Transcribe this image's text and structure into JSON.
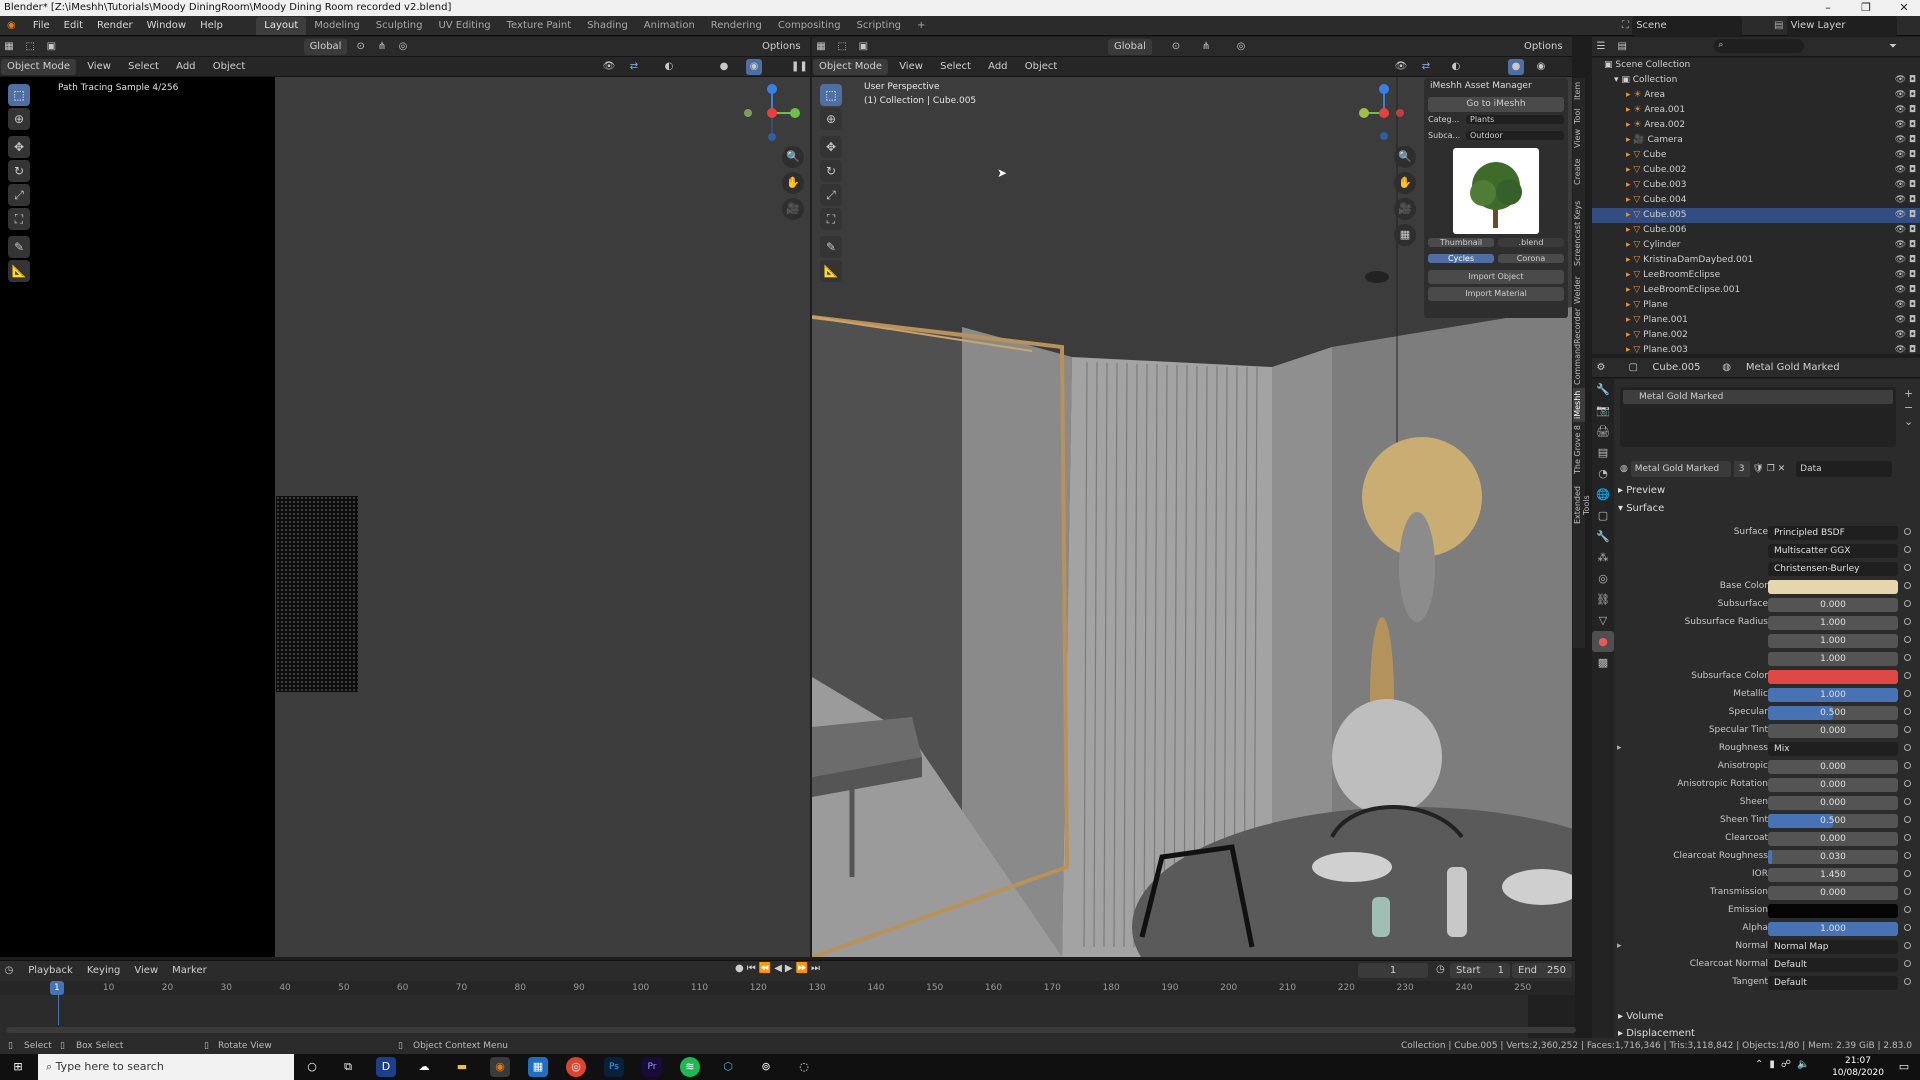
{
  "window": {
    "title": "Blender* [Z:\\iMeshh\\Tutorials\\Moody DiningRoom\\Moody Dining Room recorded v2.blend]"
  },
  "menu": [
    "File",
    "Edit",
    "Render",
    "Window",
    "Help"
  ],
  "workspaces": [
    "Layout",
    "Modeling",
    "Sculpting",
    "UV Editing",
    "Texture Paint",
    "Shading",
    "Animation",
    "Rendering",
    "Compositing",
    "Scripting",
    "+"
  ],
  "header": {
    "orientation": "Global",
    "options": "Options",
    "mode": "Object Mode",
    "view": "View",
    "select": "Select",
    "add": "Add",
    "object": "Object"
  },
  "left_viewport": {
    "overlay": "Path Tracing Sample 4/256"
  },
  "right_viewport": {
    "perspective": "User Perspective",
    "collection": "(1) Collection | Cube.005"
  },
  "imeshh": {
    "title": "iMeshh Asset Manager",
    "goto": "Go to iMeshh",
    "category_label": "Categ...",
    "category_value": "Plants",
    "subcategory_label": "Subca...",
    "subcategory_value": "Outdoor",
    "thumbnail": "Thumbnail",
    "blend": ".blend",
    "cycles": "Cycles",
    "corona": "Corona",
    "import_object": "Import Object",
    "import_material": "Import Material"
  },
  "side_tabs": [
    "Item",
    "Tool",
    "View",
    "Create",
    "Screencast Keys",
    "Welder",
    "CommandRecorder",
    "iMeshh",
    "The Grove 8",
    "Extended Tools"
  ],
  "top_right": {
    "scene": "Scene",
    "view_layer": "View Layer"
  },
  "outliner": {
    "root": "Scene Collection",
    "collection": "Collection",
    "items": [
      "Area",
      "Area.001",
      "Area.002",
      "Camera",
      "Cube",
      "Cube.002",
      "Cube.003",
      "Cube.004",
      "Cube.005",
      "Cube.006",
      "Cylinder",
      "KristinaDamDaybed.001",
      "LeeBroomEclipse",
      "LeeBroomEclipse.001",
      "Plane",
      "Plane.001",
      "Plane.002",
      "Plane.003"
    ],
    "selected": "Cube.005"
  },
  "properties": {
    "object": "Cube.005",
    "material": "Metal Gold Marked",
    "slot": "Metal Gold Marked",
    "users": "3",
    "data": "Data",
    "preview": "Preview",
    "surface_section": "Surface",
    "rows": [
      {
        "label": "Surface",
        "value": "Principled BSDF",
        "kind": "dark"
      },
      {
        "label": "",
        "value": "Multiscatter GGX",
        "kind": "dark"
      },
      {
        "label": "",
        "value": "Christensen-Burley",
        "kind": "dark"
      },
      {
        "label": "Base Color",
        "value": "",
        "kind": "color",
        "color": "#e6d6ae"
      },
      {
        "label": "Subsurface",
        "value": "0.000",
        "kind": "num"
      },
      {
        "label": "Subsurface Radius",
        "value": "1.000",
        "kind": "num"
      },
      {
        "label": "",
        "value": "1.000",
        "kind": "num"
      },
      {
        "label": "",
        "value": "1.000",
        "kind": "num"
      },
      {
        "label": "Subsurface Color",
        "value": "",
        "kind": "color",
        "color": "#e04848"
      },
      {
        "label": "Metallic",
        "value": "1.000",
        "kind": "blue",
        "fill": 1.0
      },
      {
        "label": "Specular",
        "value": "0.500",
        "kind": "blue",
        "fill": 0.5
      },
      {
        "label": "Specular Tint",
        "value": "0.000",
        "kind": "num"
      },
      {
        "label": "Roughness",
        "value": "Mix",
        "kind": "dark",
        "expand": true
      },
      {
        "label": "Anisotropic",
        "value": "0.000",
        "kind": "num"
      },
      {
        "label": "Anisotropic Rotation",
        "value": "0.000",
        "kind": "num"
      },
      {
        "label": "Sheen",
        "value": "0.000",
        "kind": "num"
      },
      {
        "label": "Sheen Tint",
        "value": "0.500",
        "kind": "blue",
        "fill": 0.5
      },
      {
        "label": "Clearcoat",
        "value": "0.000",
        "kind": "num"
      },
      {
        "label": "Clearcoat Roughness",
        "value": "0.030",
        "kind": "blue",
        "fill": 0.03
      },
      {
        "label": "IOR",
        "value": "1.450",
        "kind": "num"
      },
      {
        "label": "Transmission",
        "value": "0.000",
        "kind": "num"
      },
      {
        "label": "Emission",
        "value": "",
        "kind": "color",
        "color": "#050505"
      },
      {
        "label": "Alpha",
        "value": "1.000",
        "kind": "blue",
        "fill": 1.0
      },
      {
        "label": "Normal",
        "value": "Normal Map",
        "kind": "dark",
        "expand": true
      },
      {
        "label": "Clearcoat Normal",
        "value": "Default",
        "kind": "dark"
      },
      {
        "label": "Tangent",
        "value": "Default",
        "kind": "dark"
      }
    ],
    "volume": "Volume",
    "displacement": "Displacement"
  },
  "timeline": {
    "menus": [
      "Playback",
      "Keying",
      "View",
      "Marker"
    ],
    "current": "1",
    "start_label": "Start",
    "start": "1",
    "end_label": "End",
    "end": "250",
    "ticks": [
      "1",
      "10",
      "20",
      "30",
      "40",
      "50",
      "60",
      "70",
      "80",
      "90",
      "100",
      "110",
      "120",
      "130",
      "140",
      "150",
      "160",
      "170",
      "180",
      "190",
      "200",
      "210",
      "220",
      "230",
      "240",
      "250"
    ]
  },
  "status": {
    "select": "Select",
    "box_select": "Box Select",
    "rotate": "Rotate View",
    "context": "Object Context Menu",
    "stats": "Collection | Cube.005 | Verts:2,360,252 | Faces:1,716,346 | Tris:3,118,842 | Objects:1/80 | Mem: 2.39 GiB | 2.83.0"
  },
  "taskbar": {
    "search": "Type here to search",
    "time": "21:07",
    "date": "10/08/2020"
  }
}
